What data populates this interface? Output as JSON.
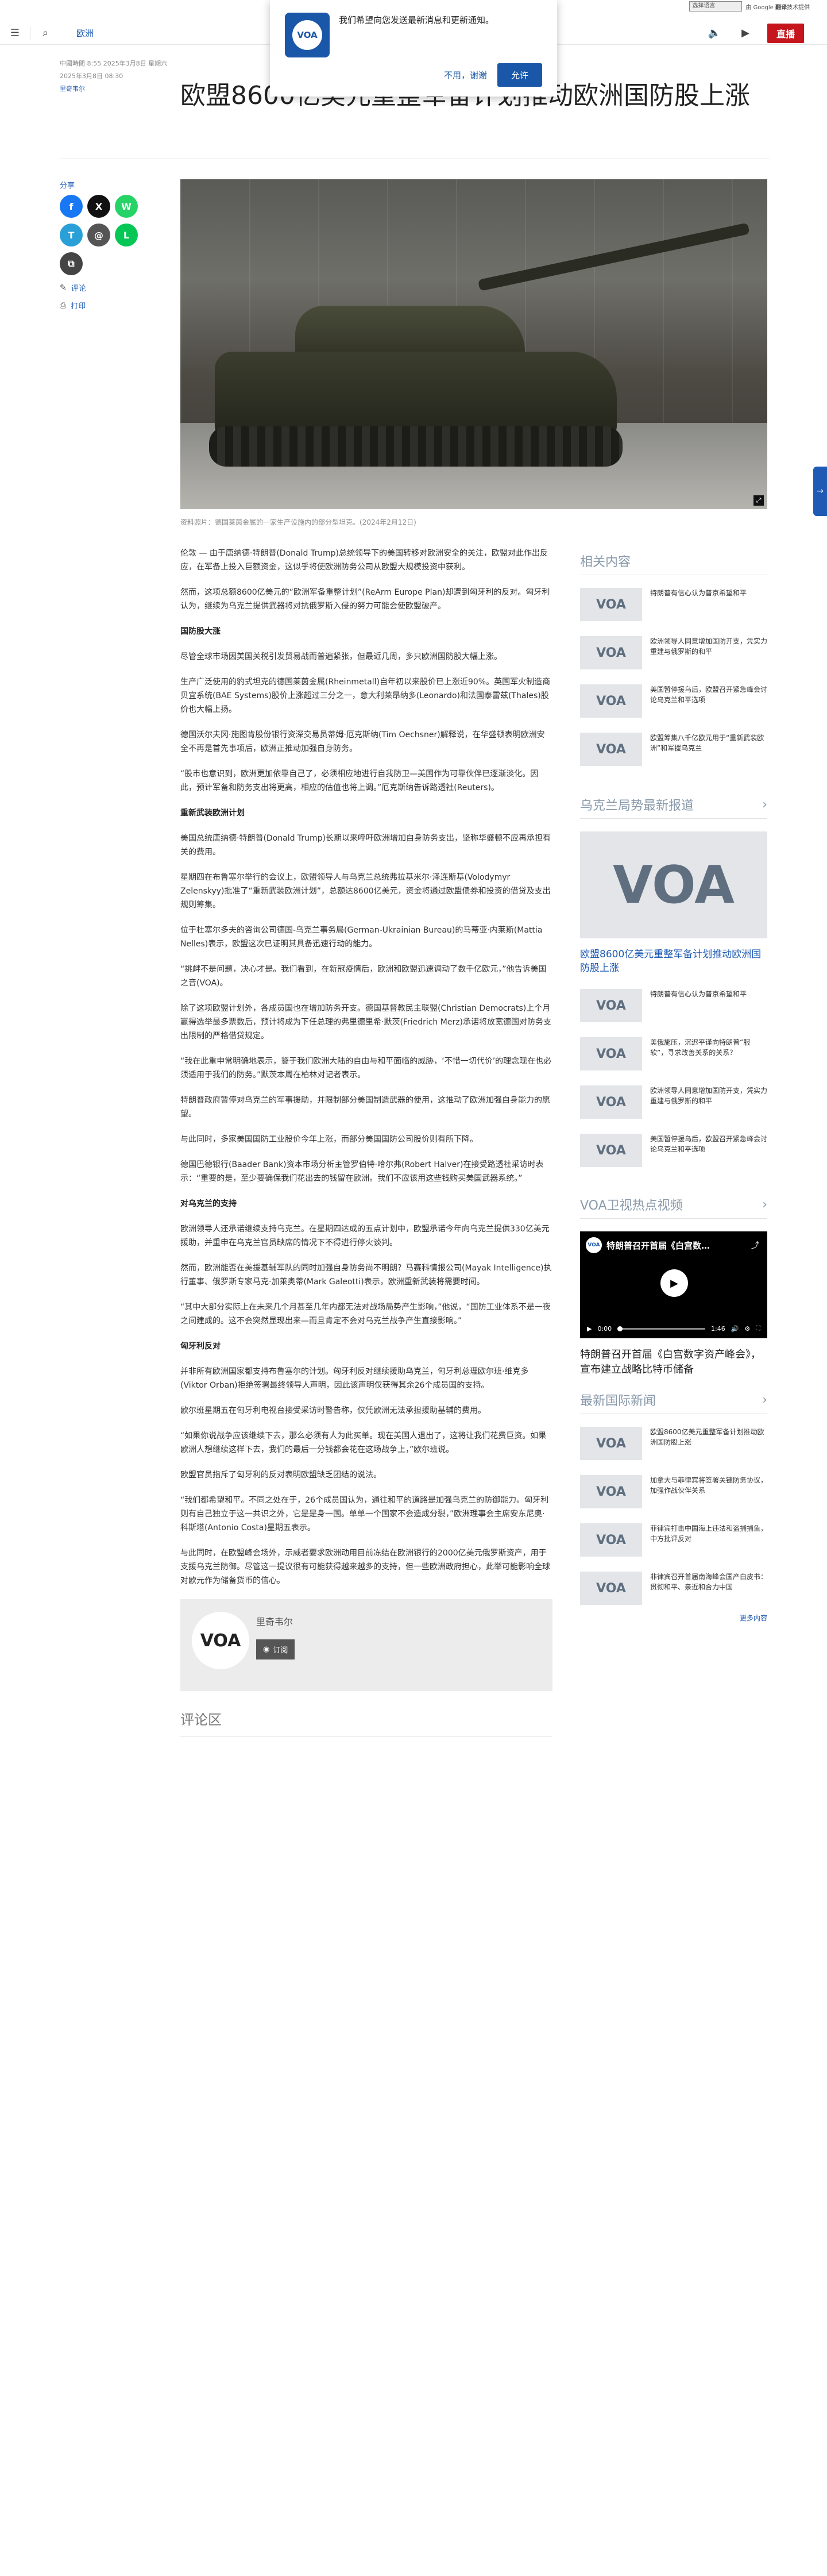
{
  "translate": {
    "select_label": "选择语言",
    "powered": "由 Google",
    "brand": "翻译",
    "suffix": "技术提供"
  },
  "header": {
    "section": "欧洲",
    "live_label": "直播"
  },
  "notification": {
    "message": "我们希望向您发送最新消息和更新通知。",
    "decline": "不用，谢谢",
    "accept": "允许",
    "logo_text": "VOA"
  },
  "article": {
    "dateline": "中國時間 8:55 2025年3月8日 星期六",
    "date": "2025年3月8日 08:30",
    "author": "里奇韦尔",
    "title": "欧盟8600亿美元重整军备计划推动欧洲国防股上涨",
    "caption": "资料照片：德国莱茵金属的一家生产设施内的部分型坦克。(2024年2月12日)",
    "paragraphs": [
      {
        "type": "p",
        "text": "伦敦 — 由于唐纳德·特朗普(Donald Trump)总统领导下的美国转移对欧洲安全的关注，欧盟对此作出反应，在军备上投入巨额资金，这似乎将使欧洲防务公司从欧盟大规模投资中获利。"
      },
      {
        "type": "p",
        "text": "然而，这项总额8600亿美元的“欧洲军备重整计划”(ReArm Europe Plan)却遭到匈牙利的反对。匈牙利认为，继续为乌克兰提供武器将对抗俄罗斯入侵的努力可能会使欧盟破产。"
      },
      {
        "type": "h",
        "text": "国防股大涨"
      },
      {
        "type": "p",
        "text": "尽管全球市场因美国关税引发贸易战而普遍紧张，但最近几周，多只欧洲国防股大幅上涨。"
      },
      {
        "type": "p",
        "text": "生产广泛使用的豹式坦克的德国莱茵金属(Rheinmetall)自年初以来股价已上涨近90%。英国军火制造商贝宜系统(BAE Systems)股价上涨超过三分之一，意大利莱昂纳多(Leonardo)和法国泰雷兹(Thales)股价也大幅上扬。"
      },
      {
        "type": "p",
        "text": "德国沃尔夫冈·施图肯股份银行资深交易员蒂姆·厄克斯纳(Tim Oechsner)解释说，在华盛顿表明欧洲安全不再是首先事项后，欧洲正推动加强自身防务。"
      },
      {
        "type": "p",
        "text": "“股市也意识到，欧洲更加依靠自己了，必须相应地进行自我防卫—美国作为可靠伙伴已逐渐淡化。因此，预计军备和防务支出将更高，相应的估值也将上调。”厄克斯纳告诉路透社(Reuters)。"
      },
      {
        "type": "h",
        "text": "重新武装欧洲计划"
      },
      {
        "type": "p",
        "text": "美国总统唐纳德·特朗普(Donald Trump)长期以来呼吁欧洲增加自身防务支出，坚称华盛顿不应再承担有关的费用。"
      },
      {
        "type": "p",
        "text": "星期四在布鲁塞尔举行的会议上，欧盟领导人与乌克兰总统弗拉基米尔·泽连斯基(Volodymyr Zelenskyy)批准了“重新武装欧洲计划”，总额达8600亿美元，资金将通过欧盟债券和投资的借贷及支出规则筹集。"
      },
      {
        "type": "p",
        "text": "位于杜塞尔多夫的咨询公司德国-乌克兰事务局(German-Ukrainian Bureau)的马蒂亚·内莱斯(Mattia Nelles)表示，欧盟这次已证明其具备迅速行动的能力。"
      },
      {
        "type": "p",
        "text": "“挑衅不是问题，决心才是。我们看到，在新冠疫情后，欧洲和欧盟迅速调动了数千亿欧元，”他告诉美国之音(VOA)。"
      },
      {
        "type": "p",
        "text": "除了这项欧盟计划外，各成员国也在增加防务开支。德国基督教民主联盟(Christian Democrats)上个月赢得选举最多票数后，预计将成为下任总理的弗里德里希·默茨(Friedrich Merz)承诺将放宽德国对防务支出限制的严格借贷规定。"
      },
      {
        "type": "p",
        "text": "“我在此重申常明确地表示，鉴于我们欧洲大陆的自由与和平面临的威胁，‘不惜一切代价’的理念现在也必须适用于我们的防务。”默茨本周在柏林对记者表示。"
      },
      {
        "type": "p",
        "text": "特朗普政府暂停对乌克兰的军事援助，并限制部分美国制造武器的使用，这推动了欧洲加强自身能力的愿望。"
      },
      {
        "type": "p",
        "text": "与此同时，多家美国国防工业股价今年上涨，而部分美国国防公司股价则有所下降。"
      },
      {
        "type": "p",
        "text": "德国巴德银行(Baader Bank)资本市场分析主管罗伯特·哈尔弗(Robert Halver)在接受路透社采访时表示：“重要的是，至少要确保我们花出去的钱留在欧洲。我们不应该用这些钱购买美国武器系统。”"
      },
      {
        "type": "h",
        "text": "对乌克兰的支持"
      },
      {
        "type": "p",
        "text": "欧洲领导人还承诺继续支持乌克兰。在星期四达成的五点计划中，欧盟承诺今年向乌克兰提供330亿美元援助，并重申在乌克兰官员缺席的情况下不得进行停火谈判。"
      },
      {
        "type": "p",
        "text": "然而，欧洲能否在美援基辅军队的同时加强自身防务尚不明朗？马赛科情报公司(Mayak Intelligence)执行董事、俄罗斯专家马克·加莱奥蒂(Mark Galeotti)表示，欧洲重新武装将需要时间。"
      },
      {
        "type": "p",
        "text": "“其中大部分实际上在未来几个月甚至几年内都无法对战场局势产生影响，”他说，“国防工业体系不是一夜之间建成的。这不会突然显现出来—而且肯定不会对乌克兰战争产生直接影响。”"
      },
      {
        "type": "h",
        "text": "匈牙利反对"
      },
      {
        "type": "p",
        "text": "并非所有欧洲国家都支持布鲁塞尔的计划。匈牙利反对继续援助乌克兰，匈牙利总理欧尔班·维克多(Viktor Orban)拒绝签署最终领导人声明，因此该声明仅获得其余26个成员国的支持。"
      },
      {
        "type": "p",
        "text": "欧尔班星期五在匈牙利电视台接受采访时警告称，仅凭欧洲无法承担援助基辅的费用。"
      },
      {
        "type": "p",
        "text": "“如果你说战争应该继续下去，那么必须有人为此买单。现在美国人退出了，这将让我们花费巨资。如果欧洲人想继续这样下去，我们的最后一分钱都会花在这场战争上，”欧尔班说。"
      },
      {
        "type": "p",
        "text": "欧盟官员指斥了匈牙利的反对表明欧盟缺乏团结的说法。"
      },
      {
        "type": "p",
        "text": "“我们都希望和平。不同之处在于，26个成员国认为，通往和平的道路是加强乌克兰的防御能力。匈牙利则有自己独立于这一共识之外，它是是身一国。单单一个国家不会造成分裂，”欧洲理事会主席安东尼奥·科斯塔(Antonio Costa)星期五表示。"
      },
      {
        "type": "p",
        "text": "与此同时，在欧盟峰会场外，示威者要求欧洲动用目前冻结在欧洲银行的2000亿美元俄罗斯资产，用于支援乌克兰防御。尽管这一提议很有可能获得越来越多的支持，但一些欧洲政府担心，此举可能影响全球对欧元作为储备货币的信心。"
      }
    ]
  },
  "share": {
    "label": "分享",
    "buttons": [
      "f",
      "X",
      "W",
      "T",
      "@",
      "L",
      "⧉"
    ],
    "comment_link": "评论",
    "print_link": "打印"
  },
  "author_box": {
    "name": "里奇韦尔",
    "avatar_text": "VOA",
    "subscribe": "订阅"
  },
  "comments": {
    "title": "评论区"
  },
  "rail": {
    "related": {
      "title": "相关内容",
      "items": [
        "特朗普有信心认为普京希望和平",
        "欧洲领导人同意增加国防开支，凭实力重建与俄罗斯的和平",
        "美国暂停援乌后，欧盟召开紧急峰会讨论乌克兰和平选项",
        "欧盟筹集八千亿欧元用于“重新武装欧洲”和军援乌克兰"
      ]
    },
    "ukraine": {
      "title": "乌克兰局势最新报道",
      "headline": "欧盟8600亿美元重整军备计划推动欧洲国防股上涨",
      "items": [
        "特朗普有信心认为普京希望和平",
        "美俄施压，沉迟平谨向特朗普“服软”，寻求改善关系的关系？",
        "欧洲领导人同意增加国防开支，凭实力重建与俄罗斯的和平",
        "美国暂停援乌后，欧盟召开紧急峰会讨论乌克兰和平选项"
      ]
    },
    "video": {
      "title": "VOA卫视热点视频",
      "player_title": "特朗普召开首届《白宫数…",
      "time_cur": "0:00",
      "time_total": "1:46",
      "caption": "特朗普召开首届《白宫数字资产峰会》，宣布建立战略比特币储备"
    },
    "intl": {
      "title": "最新国际新闻",
      "items": [
        "欧盟8600亿美元重整军备计划推动欧洲国防股上涨",
        "加拿大与菲律宾将签署关键防务协议，加强作战伙伴关系",
        "菲律宾打击中国海上违法和盗捕捕鱼，中方批评反对",
        "非律宾召开首届南海峰会国产白皮书：贯彻和平、亲近和合力中国"
      ],
      "more": "更多内容"
    }
  },
  "icons": {
    "thumb_text": "VOA"
  },
  "colors": {
    "accent": "#1f5bb5",
    "live": "#c4161c",
    "voa_blue": "#1a57a8"
  }
}
